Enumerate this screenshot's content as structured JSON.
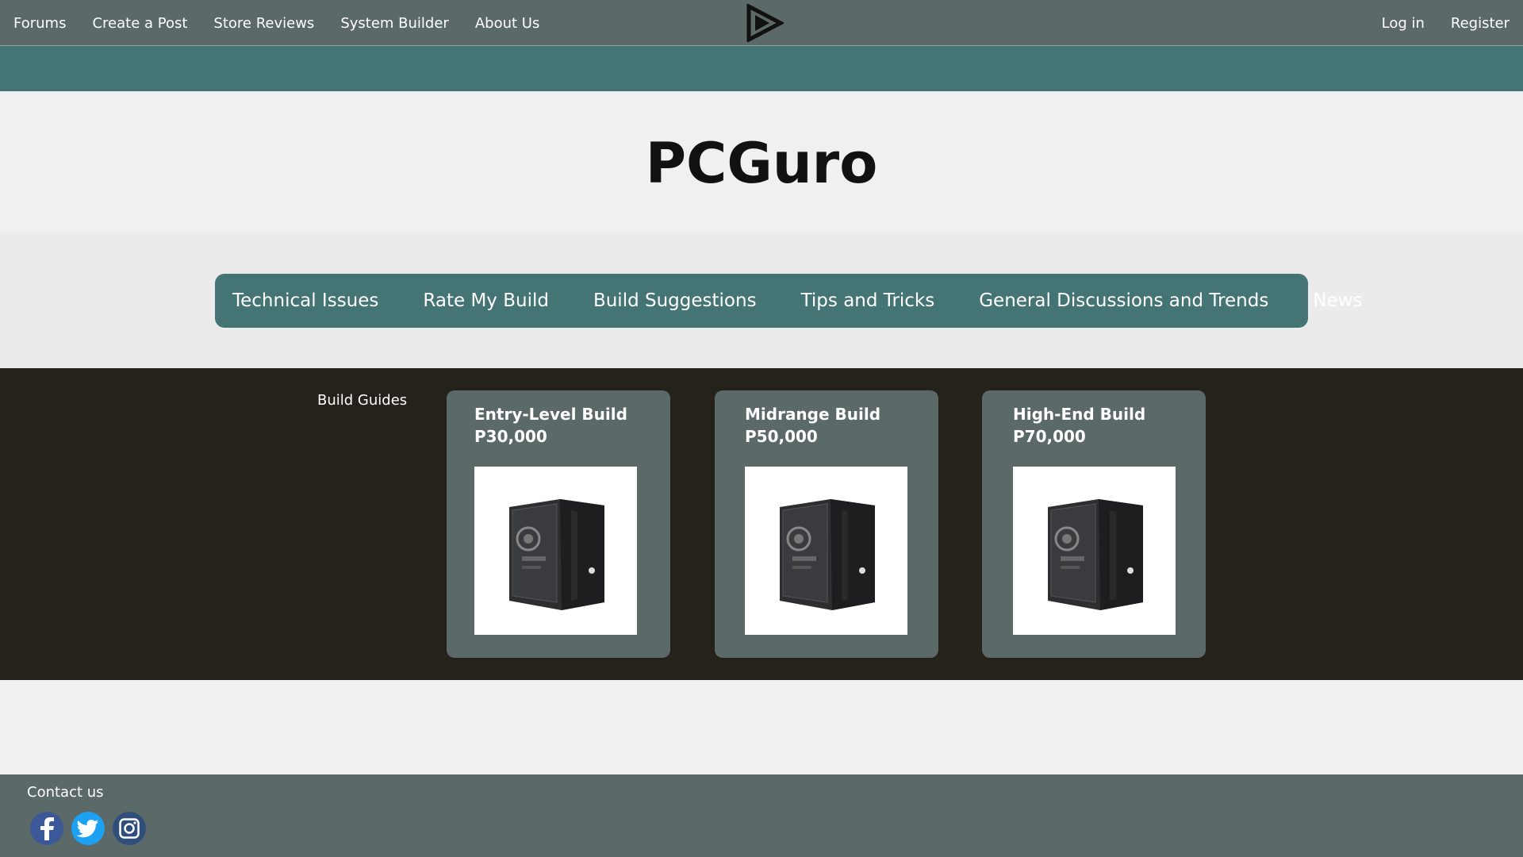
{
  "nav": {
    "left": [
      "Forums",
      "Create a Post",
      "Store Reviews",
      "System Builder",
      "About Us"
    ],
    "right": [
      "Log in",
      "Register"
    ],
    "logo_icon": "play-triangle-logo-icon"
  },
  "hero": {
    "title": "PCGuro"
  },
  "categories": [
    "Technical Issues",
    "Rate My Build",
    "Build Suggestions",
    "Tips and Tricks",
    "General Discussions and Trends",
    "News"
  ],
  "guides": {
    "label": "Build Guides",
    "cards": [
      {
        "title": "Entry-Level Build",
        "price": "P30,000",
        "image_icon": "pc-case-image"
      },
      {
        "title": "Midrange Build",
        "price": "P50,000",
        "image_icon": "pc-case-image"
      },
      {
        "title": "High-End Build",
        "price": "P70,000",
        "image_icon": "pc-case-image"
      }
    ]
  },
  "footer": {
    "contact_label": "Contact us",
    "social": [
      "facebook-icon",
      "twitter-icon",
      "instagram-icon"
    ]
  },
  "colors": {
    "nav_bg": "#5b6969",
    "accent_teal": "#457474",
    "guides_bg": "#25221c",
    "page_bg": "#f0f0f0"
  }
}
